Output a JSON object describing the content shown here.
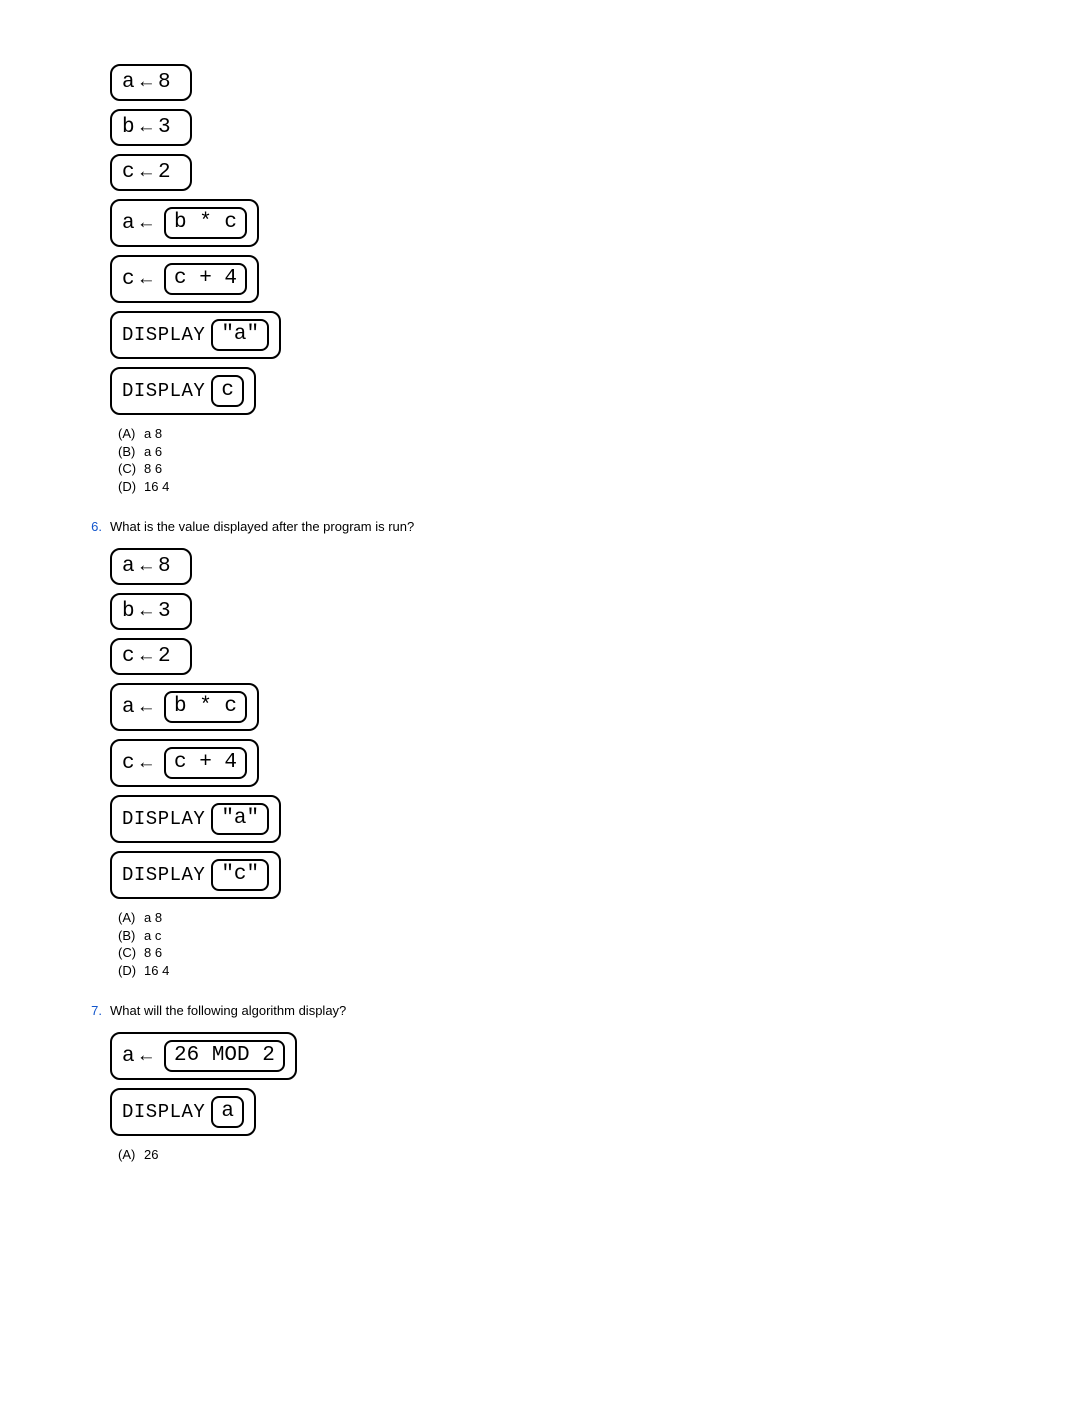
{
  "q5": {
    "blocks": [
      {
        "type": "assign",
        "lhs": "a",
        "rhs_plain": "8"
      },
      {
        "type": "assign",
        "lhs": "b",
        "rhs_plain": "3"
      },
      {
        "type": "assign",
        "lhs": "c",
        "rhs_plain": "2"
      },
      {
        "type": "assign_expr",
        "lhs": "a",
        "rhs_boxed": "b * c"
      },
      {
        "type": "assign_expr",
        "lhs": "c",
        "rhs_boxed": "c + 4"
      },
      {
        "type": "display",
        "label": "DISPLAY",
        "arg_boxed": "\"a\""
      },
      {
        "type": "display",
        "label": "DISPLAY",
        "arg_boxed": "c"
      }
    ],
    "answers": [
      {
        "label": "(A)",
        "text": "a 8"
      },
      {
        "label": "(B)",
        "text": "a 6"
      },
      {
        "label": "(C)",
        "text": "8 6"
      },
      {
        "label": "(D)",
        "text": "16 4"
      }
    ]
  },
  "q6": {
    "number": "6.",
    "prompt": "What is the value displayed after the program is run?",
    "blocks": [
      {
        "type": "assign",
        "lhs": "a",
        "rhs_plain": "8"
      },
      {
        "type": "assign",
        "lhs": "b",
        "rhs_plain": "3"
      },
      {
        "type": "assign",
        "lhs": "c",
        "rhs_plain": "2"
      },
      {
        "type": "assign_expr",
        "lhs": "a",
        "rhs_boxed": "b * c"
      },
      {
        "type": "assign_expr",
        "lhs": "c",
        "rhs_boxed": "c + 4"
      },
      {
        "type": "display",
        "label": "DISPLAY",
        "arg_boxed": "\"a\""
      },
      {
        "type": "display",
        "label": "DISPLAY",
        "arg_boxed": "\"c\""
      }
    ],
    "answers": [
      {
        "label": "(A)",
        "text": "a 8"
      },
      {
        "label": "(B)",
        "text": "a c"
      },
      {
        "label": "(C)",
        "text": "8 6"
      },
      {
        "label": "(D)",
        "text": "16 4"
      }
    ]
  },
  "q7": {
    "number": "7.",
    "prompt": "What will the following algorithm display?",
    "blocks": [
      {
        "type": "assign_expr",
        "lhs": "a",
        "rhs_boxed": "26 MOD 2"
      },
      {
        "type": "display",
        "label": "DISPLAY",
        "arg_boxed": "a"
      }
    ],
    "answers": [
      {
        "label": "(A)",
        "text": "26"
      }
    ]
  },
  "arrow_glyph": "←"
}
